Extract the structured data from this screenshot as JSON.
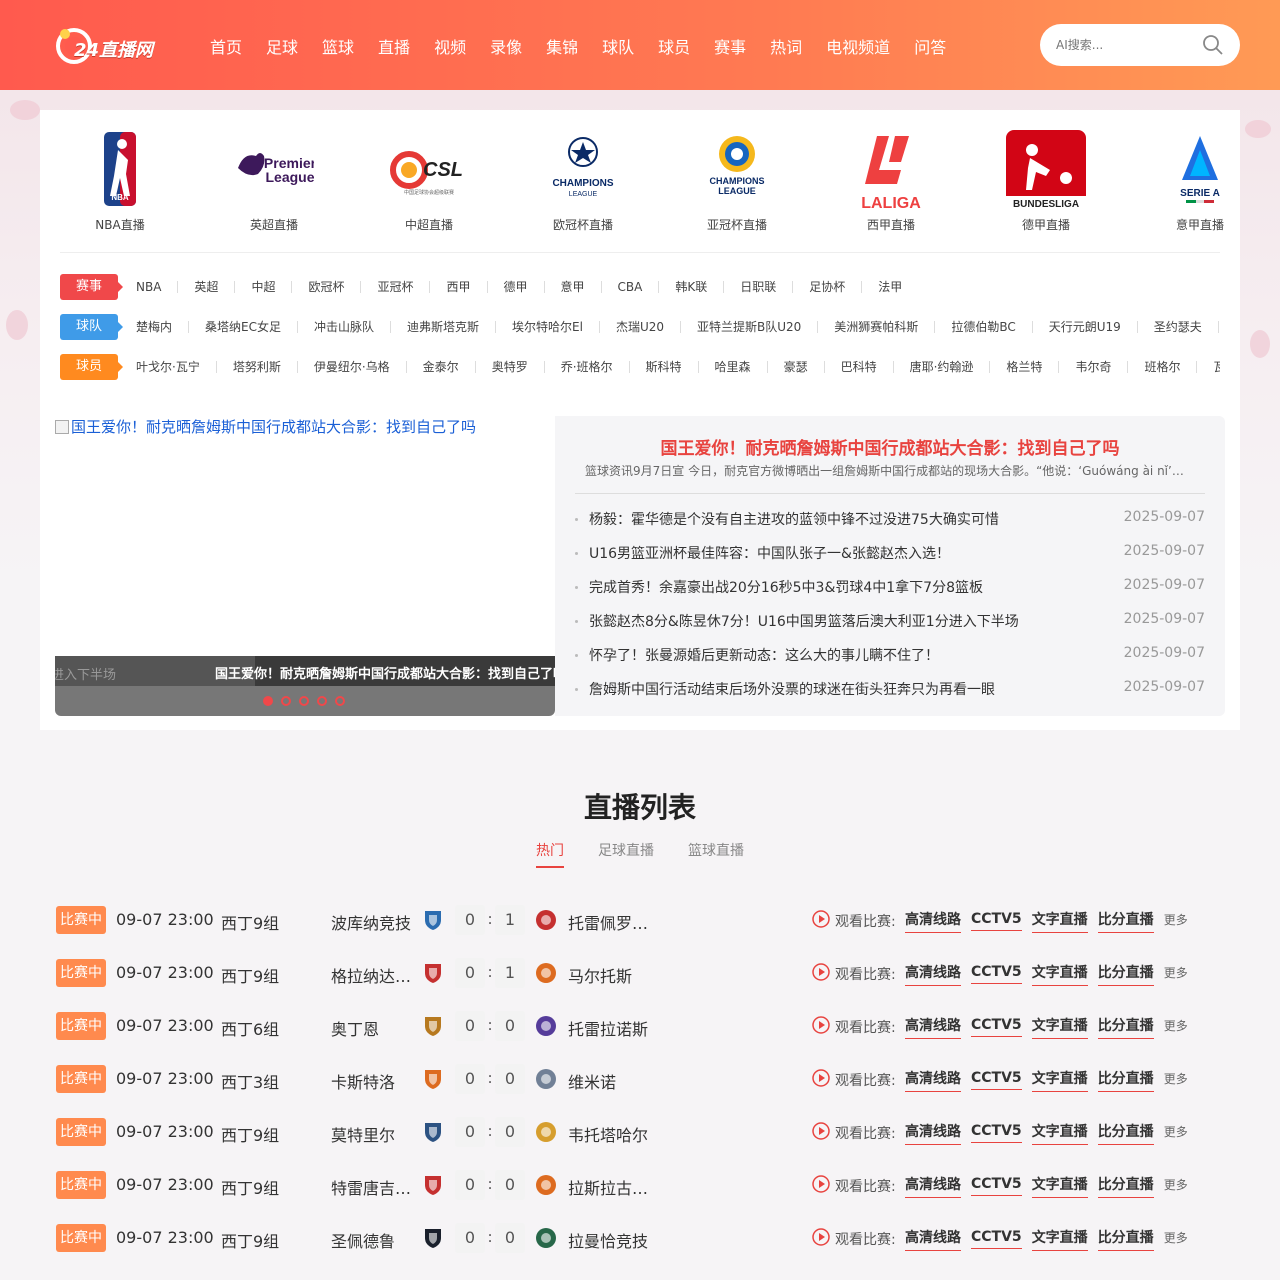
{
  "header": {
    "logo_text": "24直播网",
    "nav": [
      "首页",
      "足球",
      "篮球",
      "直播",
      "视频",
      "录像",
      "集锦",
      "球队",
      "球员",
      "赛事",
      "热词",
      "电视频道",
      "问答"
    ],
    "search_placeholder": "AI搜索...",
    "brand_color": "#ff6a50"
  },
  "leagues": [
    {
      "name": "NBA直播",
      "icon": "nba-logo"
    },
    {
      "name": "英超直播",
      "icon": "premier-league-logo"
    },
    {
      "name": "中超直播",
      "icon": "csl-logo"
    },
    {
      "name": "欧冠杯直播",
      "icon": "champions-league-logo"
    },
    {
      "name": "亚冠杯直播",
      "icon": "afc-champions-league-logo"
    },
    {
      "name": "西甲直播",
      "icon": "laliga-logo"
    },
    {
      "name": "德甲直播",
      "icon": "bundesliga-logo"
    },
    {
      "name": "意甲直播",
      "icon": "serie-a-logo"
    }
  ],
  "tag_rows": [
    {
      "label": "赛事",
      "items": [
        "NBA",
        "英超",
        "中超",
        "欧冠杯",
        "亚冠杯",
        "西甲",
        "德甲",
        "意甲",
        "CBA",
        "韩K联",
        "日职联",
        "足协杯",
        "法甲"
      ]
    },
    {
      "label": "球队",
      "items": [
        "楚梅内",
        "桑塔纳EC女足",
        "冲击山脉队",
        "迪弗斯塔克斯",
        "埃尔特哈尔El",
        "杰瑞U20",
        "亚特兰提斯B队U20",
        "美洲狮赛帕科斯",
        "拉德伯勒BC",
        "天行元朗U19",
        "圣约瑟夫",
        "关"
      ]
    },
    {
      "label": "球员",
      "items": [
        "叶戈尔·瓦宁",
        "塔努利斯",
        "伊曼纽尔·乌格",
        "金泰尔",
        "奥特罗",
        "乔·班格尔",
        "斯科特",
        "哈里森",
        "豪瑟",
        "巴科特",
        "唐耶·约翰逊",
        "格兰特",
        "韦尔奇",
        "班格尔",
        "瓦斯"
      ]
    }
  ],
  "slider": {
    "alt": "国王爱你！耐克晒詹姆斯中国行成都站大合影：找到自己了吗",
    "prev_caption": "进入下半场",
    "caption": "国王爱你！耐克晒詹姆斯中国行成都站大合影：找到自己了吗",
    "dot_count": 5
  },
  "news": {
    "headline": "国王爱你！耐克晒詹姆斯中国行成都站大合影：找到自己了吗",
    "summary": "篮球资讯9月7日宣 今日，耐克官方微博晒出一组詹姆斯中国行成都站的现场大合影。“他说：‘Guówáng ài nǐ’…",
    "items": [
      {
        "title": "杨毅：霍华德是个没有自主进攻的蓝领中锋不过没进75大确实可惜",
        "date": "2025-09-07"
      },
      {
        "title": "U16男篮亚洲杯最佳阵容：中国队张子一&张懿赵杰入选！",
        "date": "2025-09-07"
      },
      {
        "title": "完成首秀！余嘉豪出战20分16秒5中3&罚球4中1拿下7分8篮板",
        "date": "2025-09-07"
      },
      {
        "title": "张懿赵杰8分&陈昱休7分！U16中国男篮落后澳大利亚1分进入下半场",
        "date": "2025-09-07"
      },
      {
        "title": "怀孕了！张曼源婚后更新动态：这么大的事儿瞒不住了！",
        "date": "2025-09-07"
      },
      {
        "title": "詹姆斯中国行活动结束后场外没票的球迷在街头狂奔只为再看一眼",
        "date": "2025-09-07"
      }
    ]
  },
  "live": {
    "title": "直播列表",
    "tabs": [
      {
        "label": "热门",
        "active": true
      },
      {
        "label": "足球直播",
        "active": false
      },
      {
        "label": "篮球直播",
        "active": false
      }
    ],
    "watch_label": "观看比赛:",
    "links": [
      "高清线路",
      "CCTV5",
      "文字直播",
      "比分直播"
    ],
    "more_label": "更多",
    "matches": [
      {
        "status": "比赛中",
        "time": "09-07 23:00",
        "league": "西丁9组",
        "home": "波库纳竞技",
        "home_score": "0",
        "away_score": "1",
        "away": "托雷佩罗尼斯",
        "home_color": "#2b6cb0",
        "away_color": "#c53030"
      },
      {
        "status": "比赛中",
        "time": "09-07 23:00",
        "league": "西丁9组",
        "home": "格拉纳达B队",
        "home_score": "0",
        "away_score": "1",
        "away": "马尔托斯",
        "home_color": "#c53030",
        "away_color": "#dd6b20"
      },
      {
        "status": "比赛中",
        "time": "09-07 23:00",
        "league": "西丁6组",
        "home": "奥丁恩",
        "home_score": "0",
        "away_score": "0",
        "away": "托雷拉诺斯",
        "home_color": "#b7791f",
        "away_color": "#553c9a"
      },
      {
        "status": "比赛中",
        "time": "09-07 23:00",
        "league": "西丁3组",
        "home": "卡斯特洛",
        "home_score": "0",
        "away_score": "0",
        "away": "维米诺",
        "home_color": "#dd6b20",
        "away_color": "#718096"
      },
      {
        "status": "比赛中",
        "time": "09-07 23:00",
        "league": "西丁9组",
        "home": "莫特里尔",
        "home_score": "0",
        "away_score": "0",
        "away": "韦托塔哈尔",
        "home_color": "#2c5282",
        "away_color": "#d69e2e"
      },
      {
        "status": "比赛中",
        "time": "09-07 23:00",
        "league": "西丁9组",
        "home": "特雷唐吉米诺",
        "home_score": "0",
        "away_score": "0",
        "away": "拉斯拉古纳斯",
        "home_color": "#c53030",
        "away_color": "#dd6b20"
      },
      {
        "status": "比赛中",
        "time": "09-07 23:00",
        "league": "西丁9组",
        "home": "圣佩德鲁",
        "home_score": "0",
        "away_score": "0",
        "away": "拉曼恰竞技",
        "home_color": "#1a202c",
        "away_color": "#276749"
      }
    ]
  }
}
